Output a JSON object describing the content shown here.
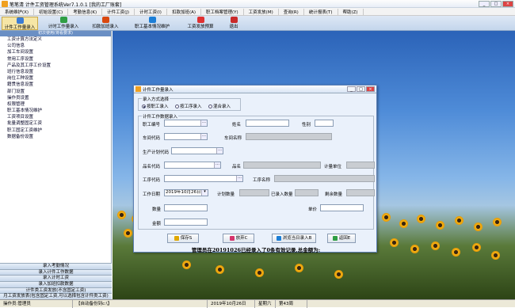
{
  "window": {
    "title": "笔笔清 计件工资管理系统Ver7.1.0.1 [我的工厂账套]",
    "controls": [
      "_",
      "□",
      "×"
    ]
  },
  "menu": [
    "系统维护(X)",
    "初始设置(C)",
    "考勤信息(K)",
    "计件工资(J)",
    "计时工资(I)",
    "扣款加班(A)",
    "职工档案管理(Y)",
    "工资发放(M)",
    "查询(R)",
    "统计报表(T)",
    "帮助(Z)"
  ],
  "toolbar": [
    {
      "label": "计件工作量录入",
      "icon": "list-icon",
      "color": "#3a7bd5"
    },
    {
      "label": "计时工作量录入",
      "icon": "clock-icon",
      "color": "#2f9e44"
    },
    {
      "label": "扣款加班录入",
      "icon": "money-icon",
      "color": "#d9480f"
    },
    {
      "label": "职工基本情况维护",
      "icon": "user-icon",
      "color": "#1c7ed6"
    },
    {
      "label": "工资发放预算",
      "icon": "calc-icon",
      "color": "#e03131"
    },
    {
      "label": "退出",
      "icon": "exit-icon",
      "color": "#c92a2a"
    }
  ],
  "sidebar": {
    "header": "初次使用(将看要求)",
    "items": [
      "工资计算方法定义",
      "公司信息",
      "加工车间设置",
      "常用工序设置",
      "产品及其工序工价设置",
      "班行信息设置",
      "岗位工种设置",
      "籍贯信息设置",
      "部门设置",
      "操作员设置",
      "权限管理",
      "职工基本情况维护",
      "工资项目设置",
      "批量调整固定工资",
      "职工固定工资维护",
      "数据备份设置"
    ],
    "bottom": [
      "录入考勤情况",
      "录入计件工作数据",
      "录入计时工资",
      "录入加班扣款数据",
      "计件类工资发放(不含固定工资)",
      "月工资发放表(包含固定工资,可以选择包含计件类工资)"
    ]
  },
  "dialog": {
    "title": "计件工作量录入",
    "mode_group": "录入方式选择",
    "modes": [
      "按职工录入",
      "按工序录入",
      "混合录入"
    ],
    "selected_mode": 0,
    "data_group": "计件工作数据录入",
    "fields": {
      "emp_no": {
        "label": "职工编号",
        "value": ""
      },
      "name": {
        "label": "姓名",
        "value": ""
      },
      "gender": {
        "label": "性别",
        "value": ""
      },
      "workshop_code": {
        "label": "车间代码",
        "value": ""
      },
      "workshop_name": {
        "label": "车间名称",
        "value": ""
      },
      "plan_no": {
        "label": "生产计划代码",
        "value": ""
      },
      "product_code": {
        "label": "品名代码",
        "value": ""
      },
      "product_name": {
        "label": "品名",
        "value": ""
      },
      "unit_price": {
        "label": "计量单位",
        "value": ""
      },
      "process_code": {
        "label": "工序代码",
        "value": ""
      },
      "process_name": {
        "label": "工序名称",
        "value": ""
      },
      "work_date": {
        "label": "工作日期",
        "value": "2019年10月26日"
      },
      "plan_qty": {
        "label": "计划数量",
        "value": ""
      },
      "entered_qty": {
        "label": "已录入数量",
        "value": ""
      },
      "remaining_qty": {
        "label": "剩余数量",
        "value": ""
      },
      "quantity": {
        "label": "数量",
        "value": ""
      },
      "price": {
        "label": "单价",
        "value": ""
      },
      "amount": {
        "label": "金额",
        "value": ""
      }
    },
    "buttons": [
      "保存S",
      "放弃C",
      "浏览当日录入B",
      "返回E"
    ],
    "summary": "管理员在20191026已经录入了0条有效记录,总金额为:"
  },
  "statusbar": [
    "操作员:管理员",
    "【自动备份到c:\\】",
    "2019年10月26日",
    "星期六",
    "第43周"
  ]
}
